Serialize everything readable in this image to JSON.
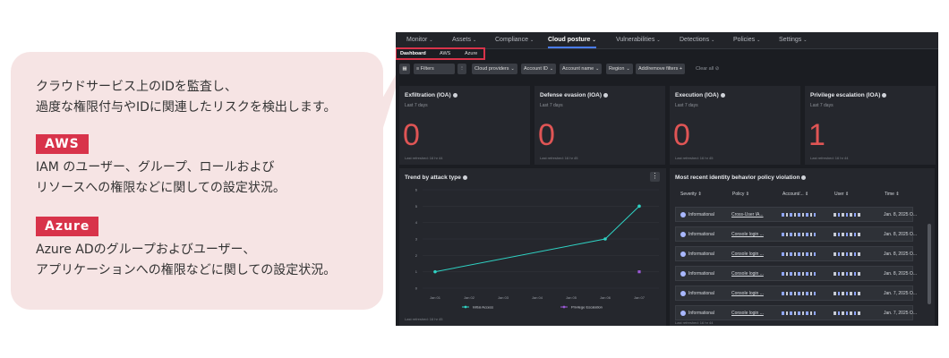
{
  "callout": {
    "intro_lines": [
      "クラウドサービス上のIDを監査し、",
      "過度な権限付与やIDに関連したリスクを検出します。"
    ],
    "aws_badge": "AWS",
    "aws_lines": [
      "IAM のユーザー、グループ、ロールおよび",
      "リソースへの権限などに関しての設定状況。"
    ],
    "azure_badge": "Azure",
    "azure_lines": [
      "Azure ADのグループおよびユーザー、",
      "アプリケーションへの権限などに関しての設定状況。"
    ],
    "colors": {
      "background": "#f6e4e4",
      "badge": "#d8334a"
    }
  },
  "app": {
    "nav": [
      {
        "label": "Monitor",
        "active": false
      },
      {
        "label": "Assets",
        "active": false
      },
      {
        "label": "Compliance",
        "active": false
      },
      {
        "label": "Cloud posture",
        "active": true
      },
      {
        "label": "Vulnerabilities",
        "active": false
      },
      {
        "label": "Detections",
        "active": false
      },
      {
        "label": "Policies",
        "active": false
      },
      {
        "label": "Settings",
        "active": false
      }
    ],
    "subtabs": [
      "Dashboard",
      "AWS",
      "Azure"
    ],
    "filters": [
      "Filters",
      "Cloud providers",
      "Account ID",
      "Account name",
      "Region",
      "Add/remove filters"
    ],
    "clear_all": "Clear all",
    "kpis": [
      {
        "title": "Exfiltration (IOA)",
        "subtitle": "Last 7 days",
        "value": "0",
        "refreshed": "Last refreshed: 16 hr 44"
      },
      {
        "title": "Defense evasion (IOA)",
        "subtitle": "Last 7 days",
        "value": "0",
        "refreshed": "Last refreshed: 16 hr 45"
      },
      {
        "title": "Execution (IOA)",
        "subtitle": "Last 7 days",
        "value": "0",
        "refreshed": "Last refreshed: 16 hr 45"
      },
      {
        "title": "Privilege escalation (IOA)",
        "subtitle": "Last 7 days",
        "value": "1",
        "refreshed": "Last refreshed: 16 hr 44"
      }
    ],
    "trend": {
      "title": "Trend by attack type",
      "refreshed": "Last refreshed: 16 hr 45",
      "chart_data": {
        "type": "line",
        "title": "Trend by attack type",
        "x": [
          "Jan 01",
          "Jan 02",
          "Jan 03",
          "Jan 04",
          "Jan 05",
          "Jan 06",
          "Jan 07"
        ],
        "yticks": [
          "0",
          "1",
          "2",
          "3",
          "4",
          "5",
          "6"
        ],
        "ylim": [
          0,
          6
        ],
        "series": [
          {
            "name": "Initial Access",
            "color": "#2fd3c4",
            "points": [
              [
                0,
                1
              ],
              [
                5,
                3
              ],
              [
                6,
                5
              ]
            ]
          },
          {
            "name": "Privilege Escalation",
            "color": "#9b59d6",
            "points": [
              [
                6,
                1
              ]
            ]
          }
        ],
        "legend": "bottom",
        "grid": true
      }
    },
    "violations": {
      "title": "Most recent identity behavior policy violation",
      "refreshed": "Last refreshed: 16 hr 44",
      "columns": [
        "Severity",
        "Policy",
        "Account/...",
        "User",
        "Time"
      ],
      "rows": [
        {
          "severity": "Informational",
          "policy": "Cross-User IA...",
          "time": "Jan. 8, 2025 O..."
        },
        {
          "severity": "Informational",
          "policy": "Console login ...",
          "time": "Jan. 8, 2025 O..."
        },
        {
          "severity": "Informational",
          "policy": "Console login ...",
          "time": "Jan. 8, 2025 O..."
        },
        {
          "severity": "Informational",
          "policy": "Console login ...",
          "time": "Jan. 8, 2025 O..."
        },
        {
          "severity": "Informational",
          "policy": "Console login ...",
          "time": "Jan. 7, 2025 O..."
        },
        {
          "severity": "Informational",
          "policy": "Console login ...",
          "time": "Jan. 7, 2025 O..."
        }
      ]
    }
  }
}
